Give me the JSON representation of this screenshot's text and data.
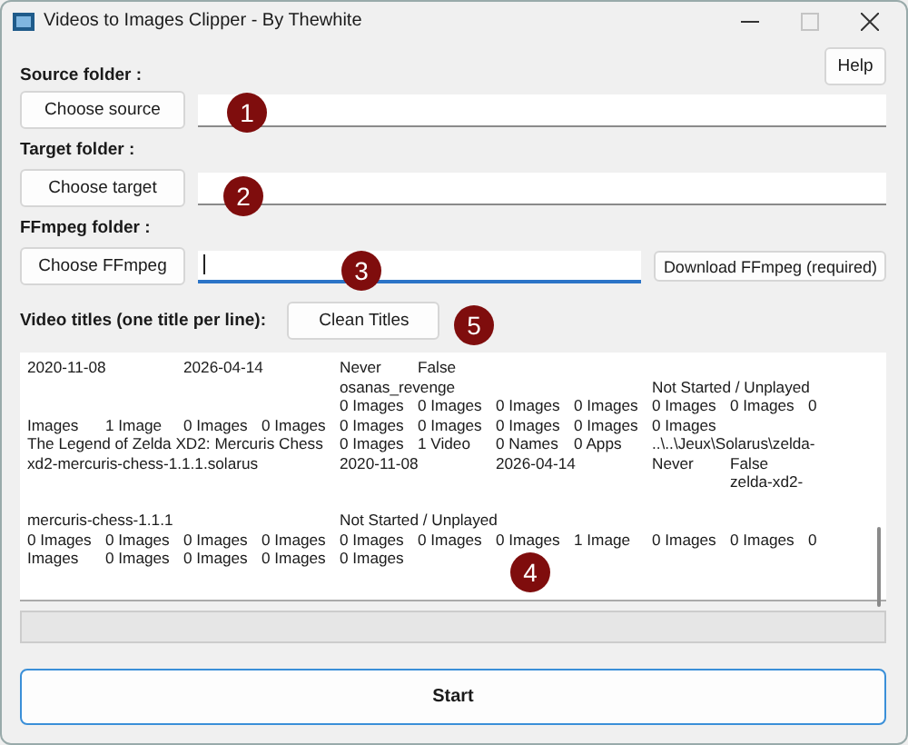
{
  "window": {
    "title": "Videos to Images Clipper - By Thewhite",
    "maximize_disabled": true
  },
  "help_button": "Help",
  "sections": [
    {
      "label": "Source folder :",
      "button": "Choose source",
      "focused": false
    },
    {
      "label": "Target folder :",
      "button": "Choose target",
      "focused": false
    },
    {
      "label": "FFmpeg folder :",
      "button": "Choose FFmpeg",
      "focused": true,
      "extra_button": "Download FFmpeg (required)"
    }
  ],
  "titles": {
    "label": "Video titles (one title per line):",
    "button": "Clean Titles",
    "value": "2020-11-08\t2026-04-14\tNever\tFalse\n\t\t\t\tosanas_revenge\t\t\tNot Started / Unplayed\n\t\t\t\t0 Images\t0 Images\t0 Images\t0 Images\t0 Images\t0 Images\t0\nImages\t1 Image\t0 Images\t0 Images\t0 Images\t0 Images\t0 Images\t0 Images\t0 Images\nThe Legend of Zelda XD2: Mercuris Chess\t0 Images\t1 Video\t0 Names\t0 Apps\t..\\..\\Jeux\\Solarus\\zelda-\nxd2-mercuris-chess-1.1.1.solarus\t\t2020-11-08\t2026-04-14\tNever\tFalse\n\t\t\t\t\t\t\t\t\tzelda-xd2-\n\nmercuris-chess-1.1.1\t\t\tNot Started / Unplayed\n0 Images\t0 Images\t0 Images\t0 Images\t0 Images\t0 Images\t0 Images\t1 Image\t0 Images\t0 Images\t0\nImages\t0 Images\t0 Images\t0 Images\t0 Images"
  },
  "progress": {
    "level": 0
  },
  "start_button": "Start",
  "markers": [
    {
      "label": "1"
    },
    {
      "label": "2"
    },
    {
      "label": "3"
    },
    {
      "label": "4"
    },
    {
      "label": "5"
    }
  ]
}
